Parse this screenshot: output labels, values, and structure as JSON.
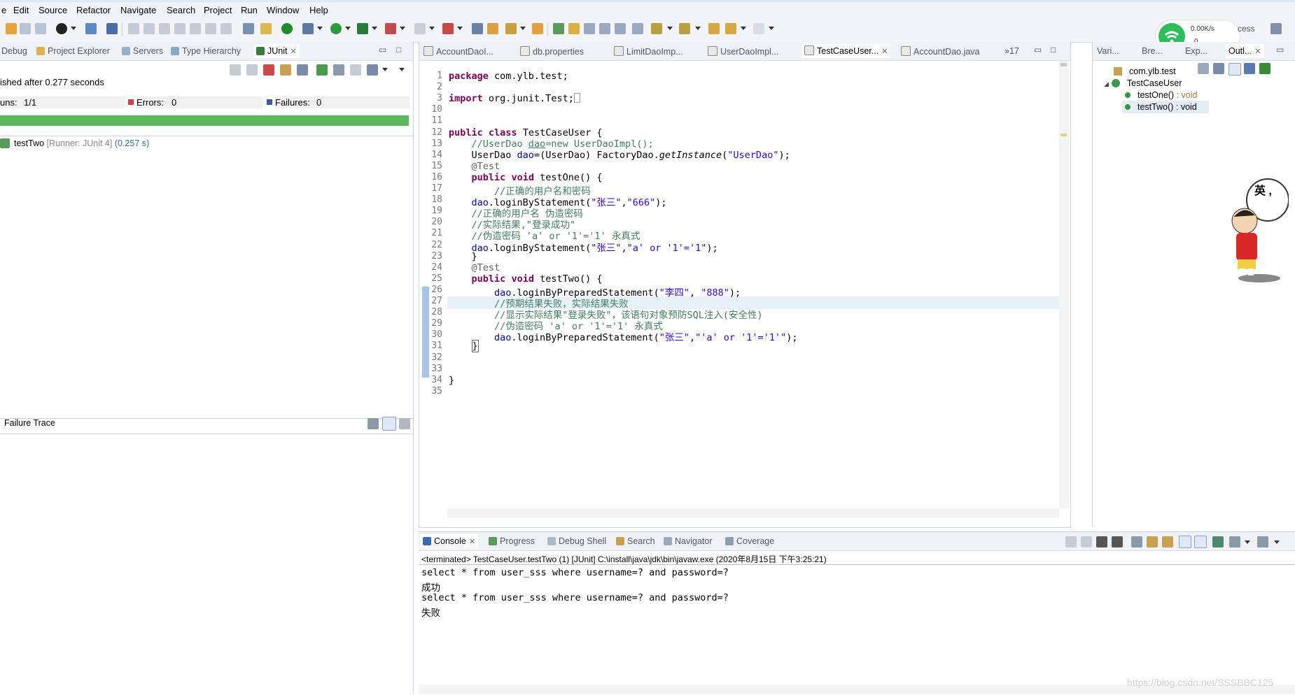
{
  "menu": [
    "e",
    "Edit",
    "Source",
    "Refactor",
    "Navigate",
    "Search",
    "Project",
    "Run",
    "Window",
    "Help"
  ],
  "network_widget": {
    "speed": "0.00K/s",
    "count": "0"
  },
  "quick_access_label": "cess",
  "left_tabs": [
    "Debug",
    "Project Explorer",
    "Servers",
    "Type Hierarchy",
    "JUnit"
  ],
  "junit": {
    "status": "ished after 0.277 seconds",
    "runs_label": "uns:",
    "runs_value": "1/1",
    "errors_label": "Errors:",
    "errors_value": "0",
    "failures_label": "Failures:",
    "failures_value": "0",
    "progress_color": "#5cb85c",
    "test_name": "testTwo",
    "test_runner": "[Runner: JUnit 4]",
    "test_time": "(0.257 s)",
    "failure_trace_label": "Failure Trace"
  },
  "editor_tabs": [
    "AccountDaoI...",
    "db.properties",
    "LimitDaoImp...",
    "UserDaoImpl...",
    "TestCaseUser...",
    "AccountDao.java"
  ],
  "editor_overflow": "»17",
  "code_lines": [
    {
      "n": "1",
      "html": "<span class='kw'>package</span> com.ylb.test;"
    },
    {
      "n": "2",
      "html": ""
    },
    {
      "n": "3",
      "html": "<span class='kw'>import</span> org.junit.Test;<span style='border:1px solid #999;display:inline-block;width:7px;height:12px;vertical-align:-2px'></span>"
    },
    {
      "n": "10",
      "html": ""
    },
    {
      "n": "11",
      "html": ""
    },
    {
      "n": "12",
      "html": "<span class='kw'>public</span> <span class='kw'>class</span> TestCaseUser {"
    },
    {
      "n": "13",
      "html": "    <span class='cm'>//UserDao <u>dao</u>=new UserDaoImpl();</span>"
    },
    {
      "n": "14",
      "html": "    UserDao <span class='fld'>dao</span>=(UserDao) FactoryDao.<span class='it'>getInstance</span>(<span class='str'>\"UserDao\"</span>);"
    },
    {
      "n": "15",
      "html": "    <span class='ann'>@Test</span>"
    },
    {
      "n": "16",
      "html": "    <span class='kw'>public</span> <span class='kw'>void</span> testOne() {"
    },
    {
      "n": "17",
      "html": "        <span class='cm'>//正确的用户名和密码</span>"
    },
    {
      "n": "18",
      "html": "    <span class='fld'>dao</span>.loginByStatement(<span class='str'>\"张三\"</span>,<span class='str'>\"666\"</span>);"
    },
    {
      "n": "19",
      "html": "    <span class='cm'>//正确的用户名 伪造密码</span>"
    },
    {
      "n": "20",
      "html": "    <span class='cm'>//实际结果,\"登录成功\"</span>"
    },
    {
      "n": "21",
      "html": "    <span class='cm'>//伪造密码 'a' or '1'='1' 永真式</span>"
    },
    {
      "n": "22",
      "html": "    <span class='fld'>dao</span>.loginByStatement(<span class='str'>\"张三\"</span>,<span class='str'>\"a' or '1'='1\"</span>);"
    },
    {
      "n": "23",
      "html": "    }"
    },
    {
      "n": "24",
      "html": "    <span class='ann'>@Test</span>"
    },
    {
      "n": "25",
      "html": "    <span class='kw'>public</span> <span class='kw'>void</span> testTwo() {"
    },
    {
      "n": "26",
      "html": "        <span class='fld'>dao</span>.loginByPreparedStatement(<span class='str'>\"李四\"</span>, <span class='str'>\"888\"</span>);"
    },
    {
      "n": "27",
      "html": "        <span class='cm'>//预期结果失败，实际结果失败</span>"
    },
    {
      "n": "28",
      "html": "        <span class='cm'>//显示实际结果\"登录失败\"，该语句对象预防SQL注入(安全性)</span>"
    },
    {
      "n": "29",
      "html": "        <span class='cm'>//伪造密码 'a' or '1'='1' 永真式</span>"
    },
    {
      "n": "30",
      "html": "        <span class='fld'>dao</span>.loginByPreparedStatement(<span class='str'>\"张三\"</span>,<span class='str'>\"'a' or '1'='1'\"</span>);"
    },
    {
      "n": "31",
      "html": "    <span style='border:1px solid #666;'>}</span>"
    },
    {
      "n": "32",
      "html": ""
    },
    {
      "n": "33",
      "html": ""
    },
    {
      "n": "34",
      "html": "}"
    },
    {
      "n": "35",
      "html": ""
    }
  ],
  "right_tabs": [
    "Vari...",
    "Bre...",
    "Exp...",
    "Outl..."
  ],
  "outline": {
    "package": "com.ylb.test",
    "class": "TestCaseUser",
    "methods": [
      {
        "name": "testOne()",
        "type": " : void"
      },
      {
        "name": "testTwo()",
        "type": " : void"
      }
    ]
  },
  "console_tabs": [
    "Console",
    "Progress",
    "Debug Shell",
    "Search",
    "Navigator",
    "Coverage"
  ],
  "console": {
    "header": "<terminated> TestCaseUser.testTwo (1) [JUnit] C:\\install\\java\\jdk\\bin\\javaw.exe (2020年8月15日 下午3:25:21)",
    "lines": [
      "select * from user_sss where username=? and password=?",
      "成功",
      "select * from user_sss where username=? and password=?",
      "失败"
    ]
  },
  "watermark": "https://blog.csdn.net/SSSBBC125",
  "sticker_text": "英 ,"
}
